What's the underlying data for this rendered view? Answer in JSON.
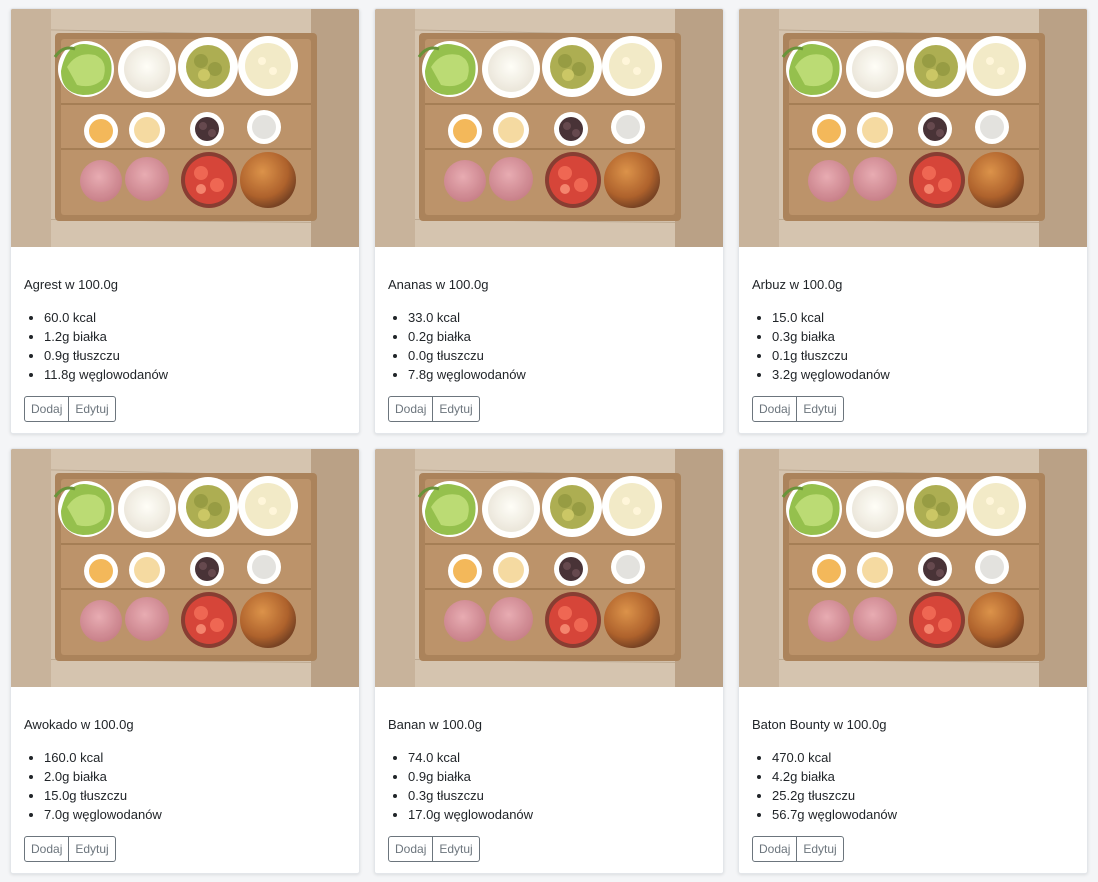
{
  "image_alt": "Składniki burgera na drewnianej desce",
  "buttons": {
    "add": "Dodaj",
    "edit": "Edytuj"
  },
  "products": [
    {
      "title": "Agrest w 100.0g",
      "kcal": "60.0 kcal",
      "protein": "1.2g białka",
      "fat": "0.9g tłuszczu",
      "carbs": "11.8g węglowodanów"
    },
    {
      "title": "Ananas w 100.0g",
      "kcal": "33.0 kcal",
      "protein": "0.2g białka",
      "fat": "0.0g tłuszczu",
      "carbs": "7.8g węglowodanów"
    },
    {
      "title": "Arbuz w 100.0g",
      "kcal": "15.0 kcal",
      "protein": "0.3g białka",
      "fat": "0.1g tłuszczu",
      "carbs": "3.2g węglowodanów"
    },
    {
      "title": "Awokado w 100.0g",
      "kcal": "160.0 kcal",
      "protein": "2.0g białka",
      "fat": "15.0g tłuszczu",
      "carbs": "7.0g węglowodanów"
    },
    {
      "title": "Banan w 100.0g",
      "kcal": "74.0 kcal",
      "protein": "0.9g białka",
      "fat": "0.3g tłuszczu",
      "carbs": "17.0g węglowodanów"
    },
    {
      "title": "Baton Bounty w 100.0g",
      "kcal": "470.0 kcal",
      "protein": "4.2g białka",
      "fat": "25.2g tłuszczu",
      "carbs": "56.7g węglowodanów"
    }
  ]
}
